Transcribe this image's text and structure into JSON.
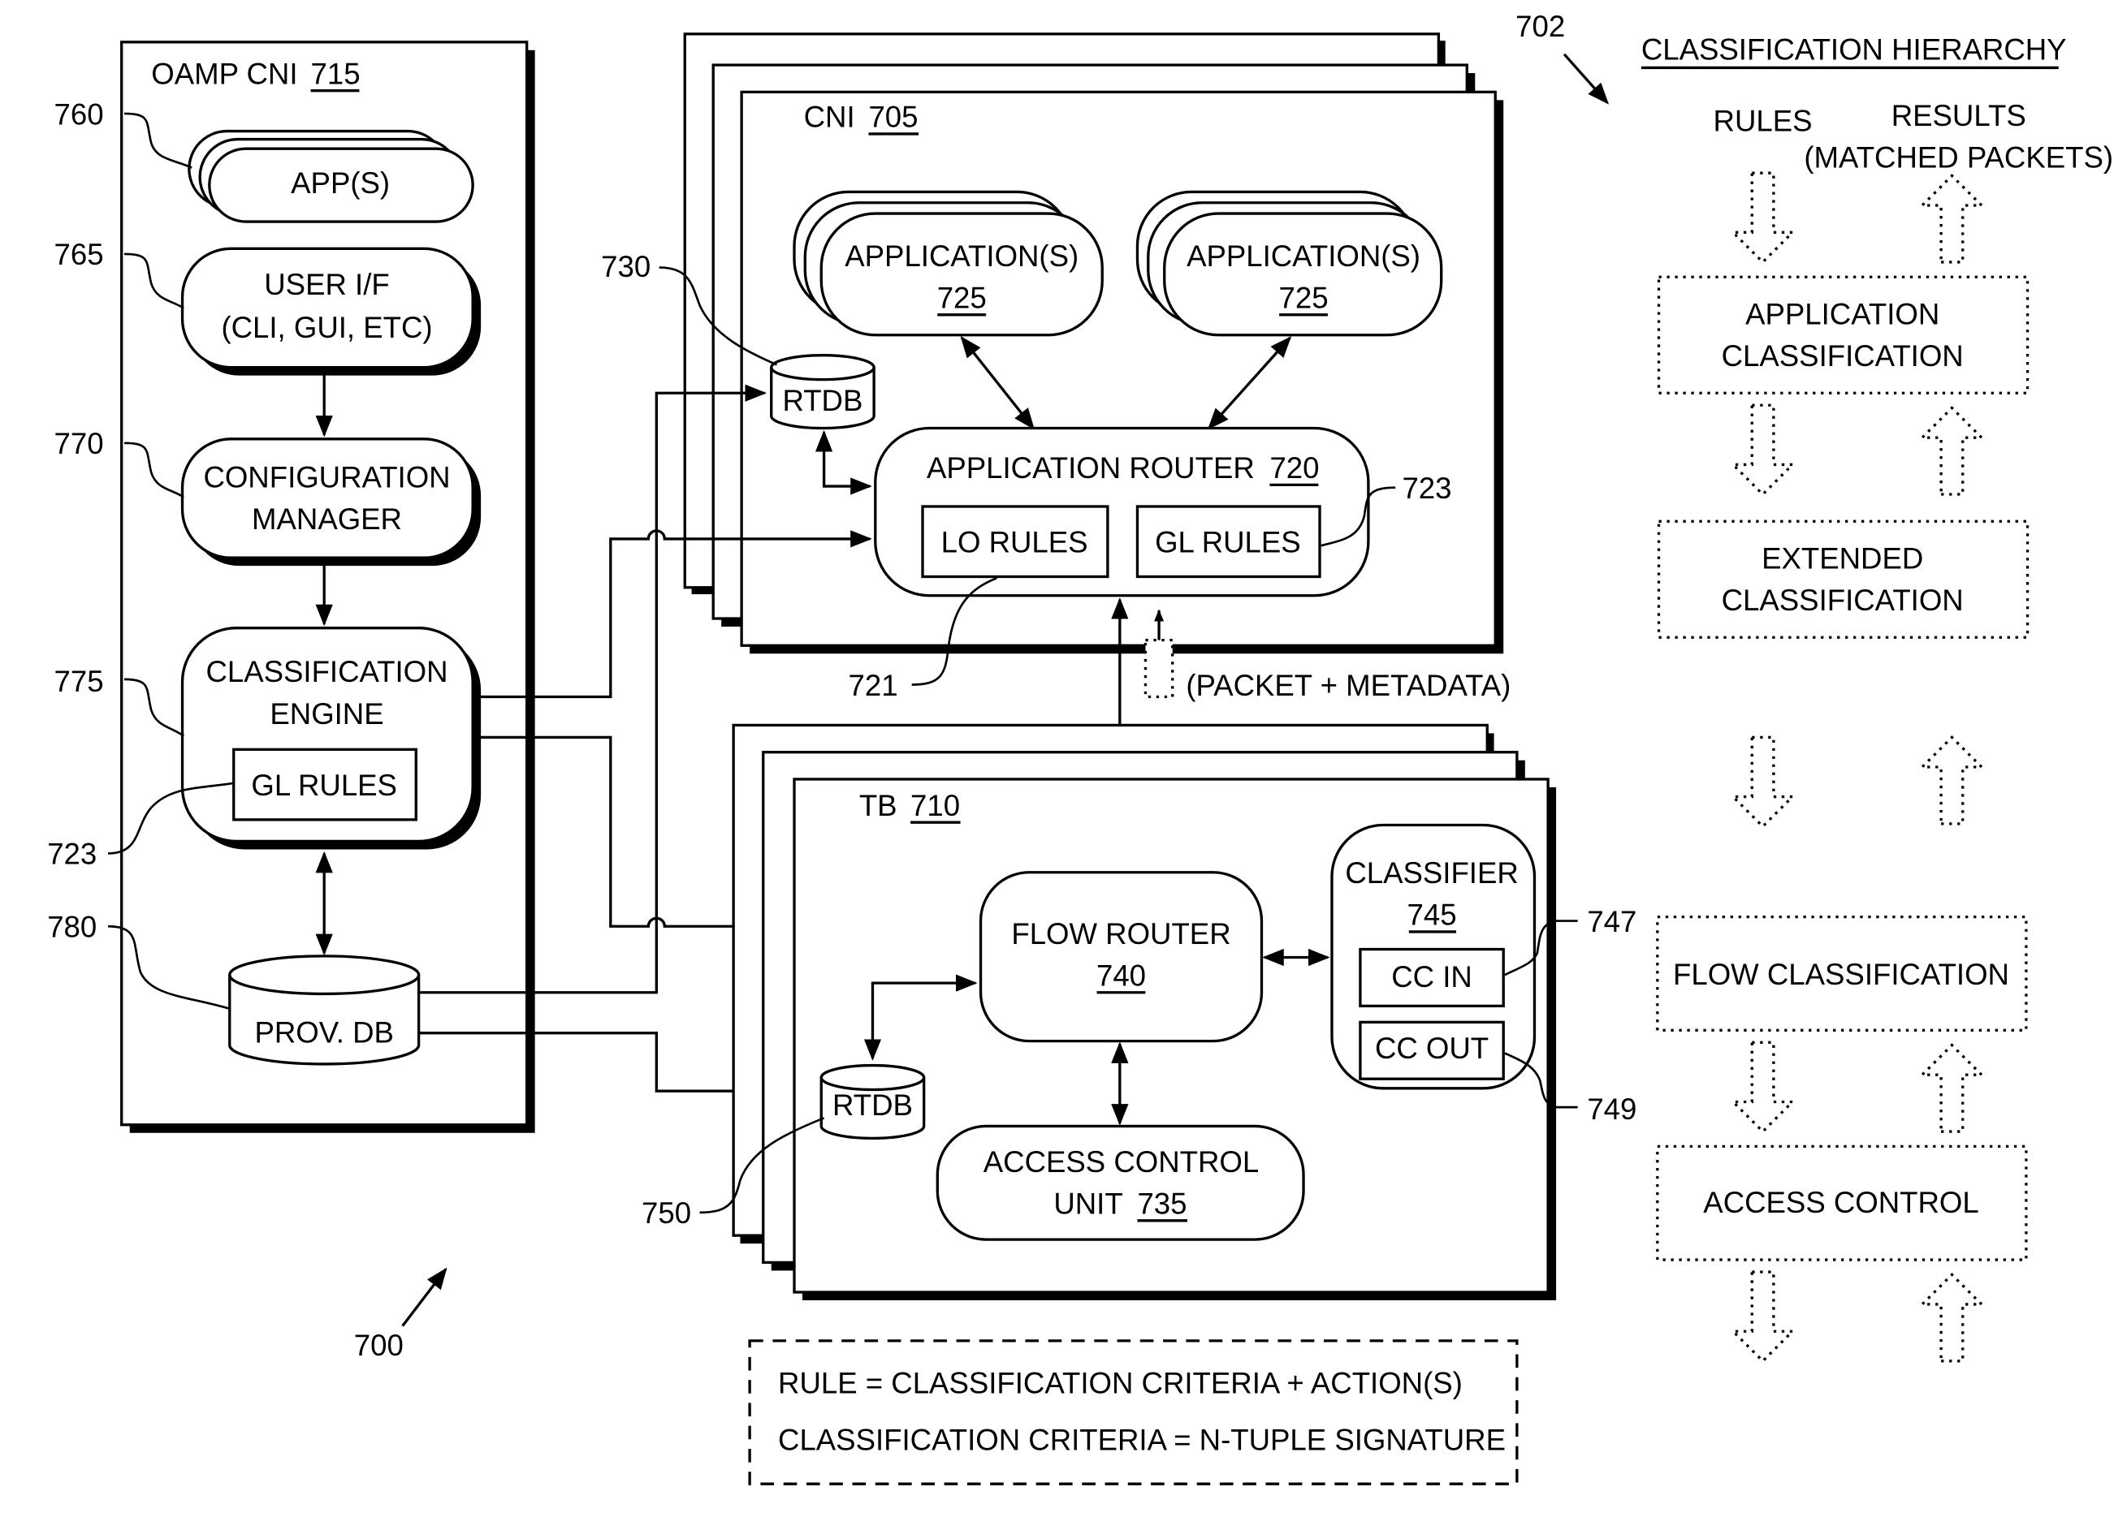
{
  "figure": {
    "ref": "700",
    "oamp": {
      "title": "OAMP CNI",
      "ref": "715",
      "apps": {
        "label": "APP(S)",
        "ref": "760"
      },
      "user_if": {
        "line1": "USER I/F",
        "line2": "(CLI, GUI, ETC)",
        "ref": "765"
      },
      "config_mgr": {
        "line1": "CONFIGURATION",
        "line2": "MANAGER",
        "ref": "770"
      },
      "class_engine": {
        "line1": "CLASSIFICATION",
        "line2": "ENGINE",
        "ref": "775",
        "gl_rules": "GL RULES",
        "gl_ref": "723"
      },
      "prov_db": {
        "label": "PROV. DB",
        "ref": "780"
      }
    },
    "cni": {
      "title": "CNI",
      "ref": "705",
      "app1": {
        "line1": "APPLICATION(S)",
        "ref": "725"
      },
      "app2": {
        "line1": "APPLICATION(S)",
        "ref": "725"
      },
      "rtdb": {
        "label": "RTDB",
        "ref": "730"
      },
      "app_router": {
        "label": "APPLICATION ROUTER",
        "ref": "720",
        "lo_rules": "LO RULES",
        "lo_ref": "721",
        "gl_rules": "GL RULES",
        "gl_ref": "723"
      }
    },
    "packet_label": "(PACKET + METADATA)",
    "tb": {
      "title": "TB",
      "ref": "710",
      "flow_router": {
        "line1": "FLOW ROUTER",
        "ref": "740"
      },
      "classifier": {
        "line1": "CLASSIFIER",
        "ref": "745",
        "cc_in": "CC IN",
        "cc_in_ref": "747",
        "cc_out": "CC OUT",
        "cc_out_ref": "749"
      },
      "rtdb": {
        "label": "RTDB",
        "ref": "750"
      },
      "acu": {
        "line1": "ACCESS CONTROL",
        "line2": "UNIT",
        "ref": "735"
      }
    },
    "legend": {
      "line1": "RULE = CLASSIFICATION CRITERIA + ACTION(S)",
      "line2": "CLASSIFICATION CRITERIA = N-TUPLE SIGNATURE"
    },
    "hierarchy": {
      "ref": "702",
      "title": "CLASSIFICATION HIERARCHY",
      "rules_label": "RULES",
      "results_line1": "RESULTS",
      "results_line2": "(MATCHED PACKETS)",
      "levels": [
        {
          "line1": "APPLICATION",
          "line2": "CLASSIFICATION"
        },
        {
          "line1": "EXTENDED",
          "line2": "CLASSIFICATION"
        },
        {
          "line1": "FLOW CLASSIFICATION",
          "line2": ""
        },
        {
          "line1": "ACCESS CONTROL",
          "line2": ""
        }
      ]
    }
  }
}
